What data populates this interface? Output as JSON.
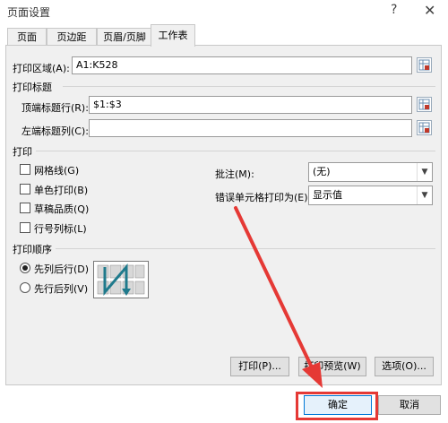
{
  "window": {
    "title": "页面设置",
    "help_label": "?",
    "close_label": "✕"
  },
  "tabs": [
    {
      "label": "页面",
      "active": false
    },
    {
      "label": "页边距",
      "active": false
    },
    {
      "label": "页眉/页脚",
      "active": false
    },
    {
      "label": "工作表",
      "active": true
    }
  ],
  "print_area": {
    "label": "打印区域(A):",
    "value": "A1:K528"
  },
  "print_titles": {
    "section": "打印标题",
    "rows_label": "顶端标题行(R):",
    "rows_value": "$1:$3",
    "cols_label": "左端标题列(C):",
    "cols_value": ""
  },
  "print": {
    "section": "打印",
    "gridlines": {
      "label": "网格线(G)",
      "checked": false
    },
    "mono": {
      "label": "单色打印(B)",
      "checked": false
    },
    "draft": {
      "label": "草稿品质(Q)",
      "checked": false
    },
    "headings": {
      "label": "行号列标(L)",
      "checked": false
    },
    "comments_label": "批注(M):",
    "comments_value": "(无)",
    "errors_label": "错误单元格打印为(E):",
    "errors_value": "显示值"
  },
  "order": {
    "section": "打印顺序",
    "down_then_over": {
      "label": "先列后行(D)",
      "selected": true
    },
    "over_then_down": {
      "label": "先行后列(V)",
      "selected": false
    }
  },
  "buttons": {
    "print": "打印(P)...",
    "preview": "打印预览(W)",
    "options": "选项(O)...",
    "ok": "确定",
    "cancel": "取消"
  },
  "colors": {
    "annotation": "#e53935",
    "accent": "#0078d7"
  }
}
